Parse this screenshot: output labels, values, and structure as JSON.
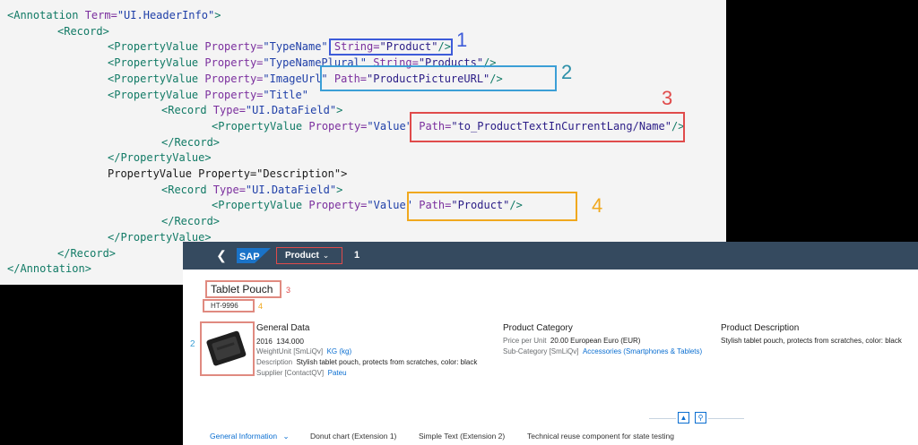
{
  "code": {
    "lines": [
      {
        "tokens": [
          [
            "tag",
            "<Annotation "
          ],
          [
            "attr",
            "Term="
          ],
          [
            "str",
            "\"UI.HeaderInfo\""
          ],
          [
            "tag",
            ">"
          ]
        ]
      },
      {
        "tokens": [
          [
            "tag",
            "<Record>"
          ]
        ]
      },
      {
        "tokens": [
          [
            "tag",
            "<PropertyValue "
          ],
          [
            "attr",
            "Property="
          ],
          [
            "str",
            "\"TypeName\""
          ],
          [
            "plain",
            " "
          ],
          [
            "attr",
            "String="
          ],
          [
            "strp",
            "\"Product\""
          ],
          [
            "tag",
            "/>"
          ]
        ]
      },
      {
        "tokens": [
          [
            "tag",
            "<PropertyValue "
          ],
          [
            "attr",
            "Property="
          ],
          [
            "str",
            "\"TypeNamePlural\""
          ],
          [
            "plain",
            " "
          ],
          [
            "attr",
            "String="
          ],
          [
            "strp",
            "\"Products\""
          ],
          [
            "tag",
            "/>"
          ]
        ]
      },
      {
        "tokens": [
          [
            "tag",
            "<PropertyValue "
          ],
          [
            "attr",
            "Property="
          ],
          [
            "str",
            "\"ImageUrl\""
          ],
          [
            "plain",
            " "
          ],
          [
            "attr",
            "Path="
          ],
          [
            "strp",
            "\"ProductPictureURL\""
          ],
          [
            "tag",
            "/>"
          ]
        ]
      },
      {
        "tokens": [
          [
            "tag",
            "<PropertyValue "
          ],
          [
            "attr",
            "Property="
          ],
          [
            "str",
            "\"Title\""
          ]
        ]
      },
      {
        "tokens": [
          [
            "tag",
            "<Record "
          ],
          [
            "attr",
            "Type="
          ],
          [
            "str",
            "\"UI.DataField\""
          ],
          [
            "tag",
            ">"
          ]
        ]
      },
      {
        "tokens": [
          [
            "tag",
            "<PropertyValue "
          ],
          [
            "attr",
            "Property="
          ],
          [
            "str",
            "\"Value\""
          ],
          [
            "plain",
            " "
          ],
          [
            "attr",
            "Path="
          ],
          [
            "strp",
            "\"to_ProductTextInCurrentLang/Name\""
          ],
          [
            "tag",
            "/>"
          ]
        ]
      },
      {
        "tokens": [
          [
            "tag",
            "</Record>"
          ]
        ]
      },
      {
        "tokens": [
          [
            "tag",
            "</PropertyValue>"
          ]
        ]
      },
      {
        "tokens": [
          [
            "plain",
            "PropertyValue Property=\"Description\">"
          ]
        ]
      },
      {
        "tokens": [
          [
            "tag",
            "<Record "
          ],
          [
            "attr",
            "Type="
          ],
          [
            "str",
            "\"UI.DataField\""
          ],
          [
            "tag",
            ">"
          ]
        ]
      },
      {
        "tokens": [
          [
            "tag",
            "<PropertyValue "
          ],
          [
            "attr",
            "Property="
          ],
          [
            "str",
            "\"Value\""
          ],
          [
            "plain",
            " "
          ],
          [
            "attr",
            "Path="
          ],
          [
            "strp",
            "\"Product\""
          ],
          [
            "tag",
            "/>"
          ]
        ]
      },
      {
        "tokens": [
          [
            "tag",
            "</Record>"
          ]
        ]
      },
      {
        "tokens": [
          [
            "tag",
            "</PropertyValue>"
          ]
        ]
      },
      {
        "tokens": [
          [
            "tag",
            "</Record>"
          ]
        ]
      },
      {
        "tokens": [
          [
            "tag",
            "</Annotation>"
          ]
        ]
      }
    ]
  },
  "callouts": {
    "n1": "1",
    "n2": "2",
    "n3": "3",
    "n4": "4",
    "colors": {
      "c1": "#3d5bd9",
      "c2": "#3b9fd6",
      "c3": "#e04b4b",
      "c4": "#f0a81e"
    }
  },
  "shell": {
    "back_icon": "chevron-left-icon",
    "logo_text": "SAP",
    "app_title": "Product",
    "app_title_icon": "chevron-down-icon",
    "badge": "1"
  },
  "header": {
    "title": "Tablet Pouch",
    "subtitle": "HT-9996",
    "label_title_num": "3",
    "label_sub_num": "4",
    "label_pic_num": "2"
  },
  "groups": {
    "general": {
      "title": "General Data",
      "year": "2016",
      "year_value": "134.000",
      "weight_key": "WeightUnit [SmLiQv]",
      "weight_val": "KG (kg)",
      "desc_key": "Description",
      "desc_val": "Stylish tablet pouch, protects from scratches, color: black",
      "supplier_key": "Supplier [ContactQV]",
      "supplier_val": "Pateu"
    },
    "category": {
      "title": "Product Category",
      "price_key": "Price per Unit",
      "price_val": "20.00  European Euro (EUR)",
      "subcat_key": "Sub-Category [SmLiQv]",
      "subcat_val": "Accessories (Smartphones & Tablets)"
    },
    "description": {
      "title": "Product Description",
      "text": "Stylish tablet pouch, protects from scratches, color: black"
    }
  },
  "header_buttons": {
    "collapse": "▲",
    "pin": "⚲"
  },
  "tabs": [
    {
      "label": "General Information",
      "selected": true
    },
    {
      "label": "Donut chart (Extension 1)",
      "selected": false
    },
    {
      "label": "Simple Text (Extension 2)",
      "selected": false
    },
    {
      "label": "Technical reuse component for state testing",
      "selected": false
    }
  ],
  "tab_dropdown_icon": "chevron-down-icon"
}
